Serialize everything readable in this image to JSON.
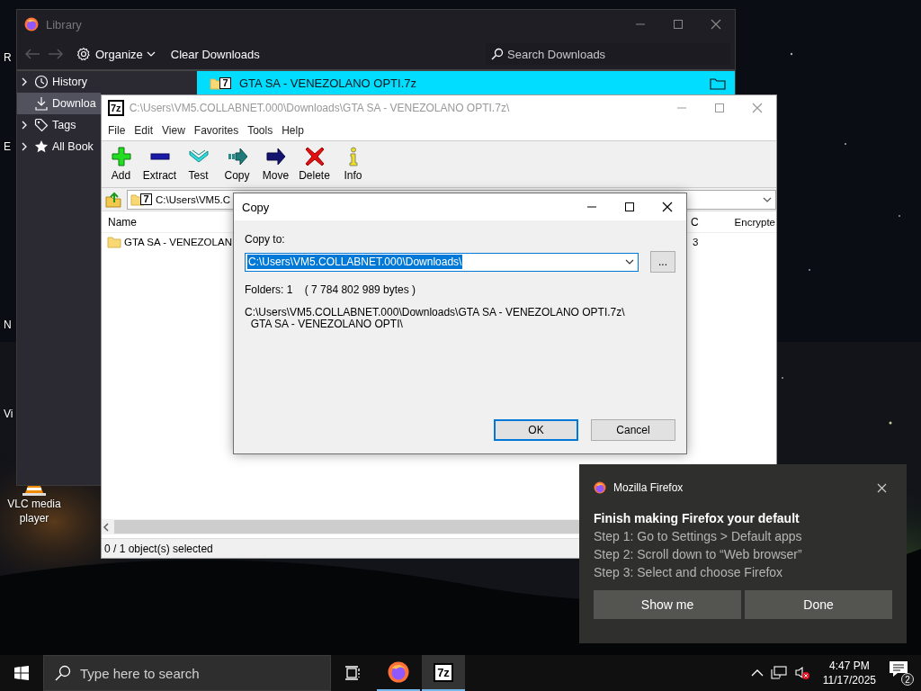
{
  "desktop": {
    "icons": [
      {
        "label": "R",
        "kind": "covered"
      },
      {
        "label": "E",
        "kind": "covered"
      },
      {
        "label": "N",
        "kind": "covered"
      },
      {
        "label": "Vi",
        "kind": "covered"
      },
      {
        "label": "VLC media player",
        "kind": "vlc"
      }
    ]
  },
  "library": {
    "title": "Library",
    "active": false,
    "toolbar": {
      "organize": "Organize",
      "clear": "Clear Downloads",
      "search_placeholder": "Search Downloads"
    },
    "sidebar": [
      {
        "label": "History",
        "has_children": true,
        "selected": false
      },
      {
        "label": "Downloa",
        "has_children": false,
        "selected": true
      },
      {
        "label": "Tags",
        "has_children": true,
        "selected": false
      },
      {
        "label": "All Book",
        "has_children": true,
        "selected": false
      }
    ],
    "downloads": [
      {
        "name": "GTA SA - VENEZOLANO OPTI.7z",
        "icon_text": "7",
        "selected": true
      }
    ]
  },
  "sevenzip": {
    "title": "C:\\Users\\VM5.COLLABNET.000\\Downloads\\GTA SA - VENEZOLANO OPTI.7z\\",
    "icon_text": "7z",
    "active": false,
    "menu": [
      "File",
      "Edit",
      "View",
      "Favorites",
      "Tools",
      "Help"
    ],
    "toolbar": [
      {
        "label": "Add",
        "kind": "add"
      },
      {
        "label": "Extract",
        "kind": "extract"
      },
      {
        "label": "Test",
        "kind": "test"
      },
      {
        "label": "Copy",
        "kind": "copy"
      },
      {
        "label": "Move",
        "kind": "move"
      },
      {
        "label": "Delete",
        "kind": "delete"
      },
      {
        "label": "Info",
        "kind": "info"
      }
    ],
    "address": {
      "value": "C:\\Users\\VM5.C",
      "icon_text": "7"
    },
    "columns": [
      "Name",
      "C",
      "Encrypte"
    ],
    "rows": [
      {
        "cells": [
          "GTA SA - VENEZOLAN",
          "3"
        ],
        "selected": false
      }
    ],
    "status": "0 / 1 object(s) selected"
  },
  "copy_dialog": {
    "title": "Copy",
    "active": true,
    "label": "Copy to:",
    "path": "C:\\Users\\VM5.COLLABNET.000\\Downloads\\",
    "browse": "...",
    "info": "Folders: 1    ( 7 784 802 989 bytes )",
    "source": [
      "C:\\Users\\VM5.COLLABNET.000\\Downloads\\GTA SA - VENEZOLANO OPTI.7z\\",
      "  GTA SA - VENEZOLANO OPTI\\"
    ],
    "buttons": [
      {
        "label": "OK",
        "default": true
      },
      {
        "label": "Cancel",
        "default": false
      }
    ]
  },
  "notification": {
    "app": "Mozilla Firefox",
    "title": "Finish making Firefox your default",
    "lines": [
      "Step 1: Go to Settings > Default apps",
      "Step 2: Scroll down to “Web browser”",
      "Step 3: Select and choose Firefox"
    ],
    "buttons": [
      "Show me",
      "Done"
    ]
  },
  "taskbar": {
    "search_placeholder": "Type here to search",
    "apps": [
      {
        "kind": "firefox",
        "selected": false
      },
      {
        "kind": "sevenzip",
        "icon_text": "7z",
        "selected": true
      }
    ],
    "volume_muted": true,
    "time": "4:47 PM",
    "date": "11/17/2025",
    "notification_count": "2"
  }
}
